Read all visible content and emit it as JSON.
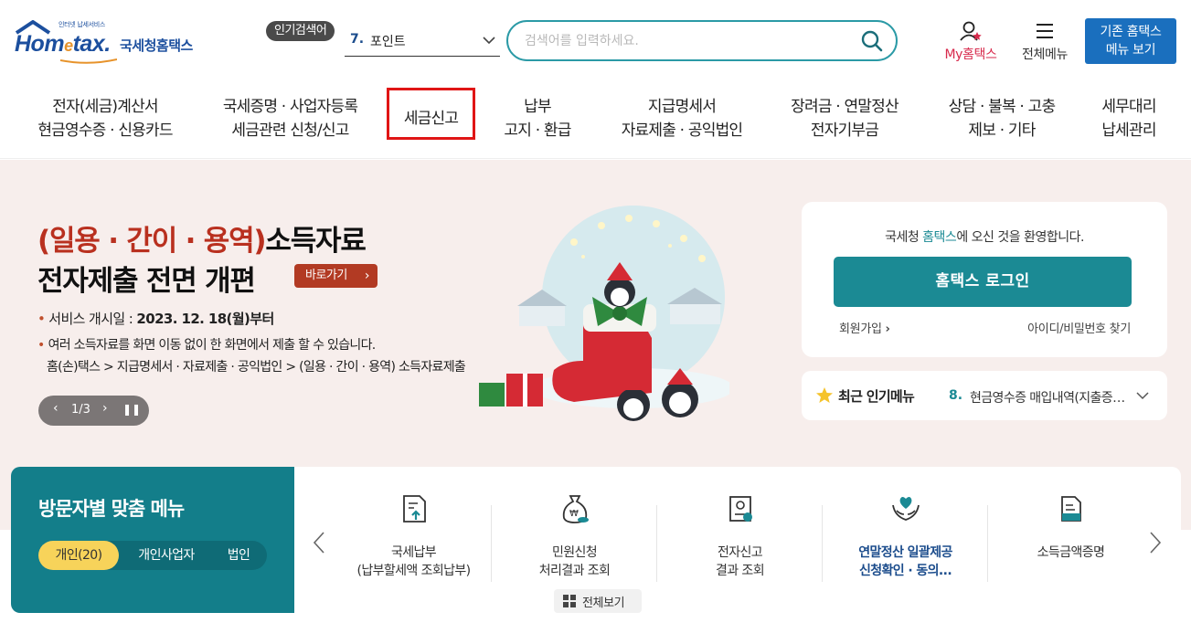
{
  "header": {
    "logo": {
      "sub": "인터넷 납세서비스",
      "text_main": "Hom",
      "text_e": "e",
      "text_tail": "tax.",
      "text_kr": "국세청홈택스"
    },
    "popular_badge": "인기검색어",
    "popular_num": "7.",
    "popular_text": "포인트",
    "search_placeholder": "검색어를 입력하세요.",
    "my_hometax": "My홈택스",
    "all_menu": "전체메뉴",
    "old_hometax_line1": "기존 홈택스",
    "old_hometax_line2": "메뉴 보기"
  },
  "gnb": [
    {
      "l1": "전자(세금)계산서",
      "l2": "현금영수증 · 신용카드"
    },
    {
      "l1": "국세증명 · 사업자등록",
      "l2": "세금관련 신청/신고"
    },
    {
      "l1": "세금신고",
      "l2": ""
    },
    {
      "l1": "납부",
      "l2": "고지 · 환급"
    },
    {
      "l1": "지급명세서",
      "l2": "자료제출 · 공익법인"
    },
    {
      "l1": "장려금 · 연말정산",
      "l2": "전자기부금"
    },
    {
      "l1": "상담 · 불복 · 고충",
      "l2": "제보 · 기타"
    },
    {
      "l1": "세무대리",
      "l2": "납세관리"
    }
  ],
  "hero": {
    "title1_red": "(일용 · 간이 · 용역)",
    "title1_rest": "소득자료",
    "title2": "전자제출 전면 개편",
    "go_button": "바로가기",
    "bullet1_label": "서비스 개시일 :",
    "bullet1_value": "2023. 12. 18(월)부터",
    "bullet2": "여러 소득자료를 화면 이동 없이 한 화면에서 제출 할 수 있습니다.",
    "bullet3": "홈(손)택스 > 지급명세서 · 자료제출 · 공익법인 > (일용 · 간이 · 용역) 소득자료제출",
    "pager": "1/3"
  },
  "login": {
    "welcome_pre": "국세청 ",
    "welcome_brand": "홈택스",
    "welcome_post": "에 오신 것을 환영합니다.",
    "login_button": "홈택스 로그인",
    "join": "회원가입",
    "find": "아이디/비밀번호 찾기"
  },
  "recent": {
    "label": "최근 인기메뉴",
    "num": "8.",
    "text": "현금영수증 매입내역(지출증빙) 조회"
  },
  "visitor": {
    "title": "방문자별 맞춤 메뉴",
    "tabs": [
      "개인(20)",
      "개인사업자",
      "법인"
    ]
  },
  "services": [
    {
      "l1": "국세납부",
      "l2": "(납부할세액 조회납부)",
      "icon": "document-upload-icon"
    },
    {
      "l1": "민원신청",
      "l2": "처리결과 조회",
      "icon": "money-bag-icon"
    },
    {
      "l1": "전자신고",
      "l2": "결과 조회",
      "icon": "stamp-document-icon"
    },
    {
      "l1": "연말정산 일괄제공",
      "l2": "신청확인 · 동의...",
      "icon": "heart-hands-icon"
    },
    {
      "l1": "소득금액증명",
      "l2": "",
      "icon": "certificate-icon"
    }
  ],
  "all_view": "전체보기",
  "colors": {
    "brand": "#1c4f9e",
    "teal": "#1b8a94",
    "dark_teal": "#137e8a",
    "hero_bg": "#f7eeec",
    "highlight_box": "#e01515",
    "accent_red": "#b9301f"
  }
}
